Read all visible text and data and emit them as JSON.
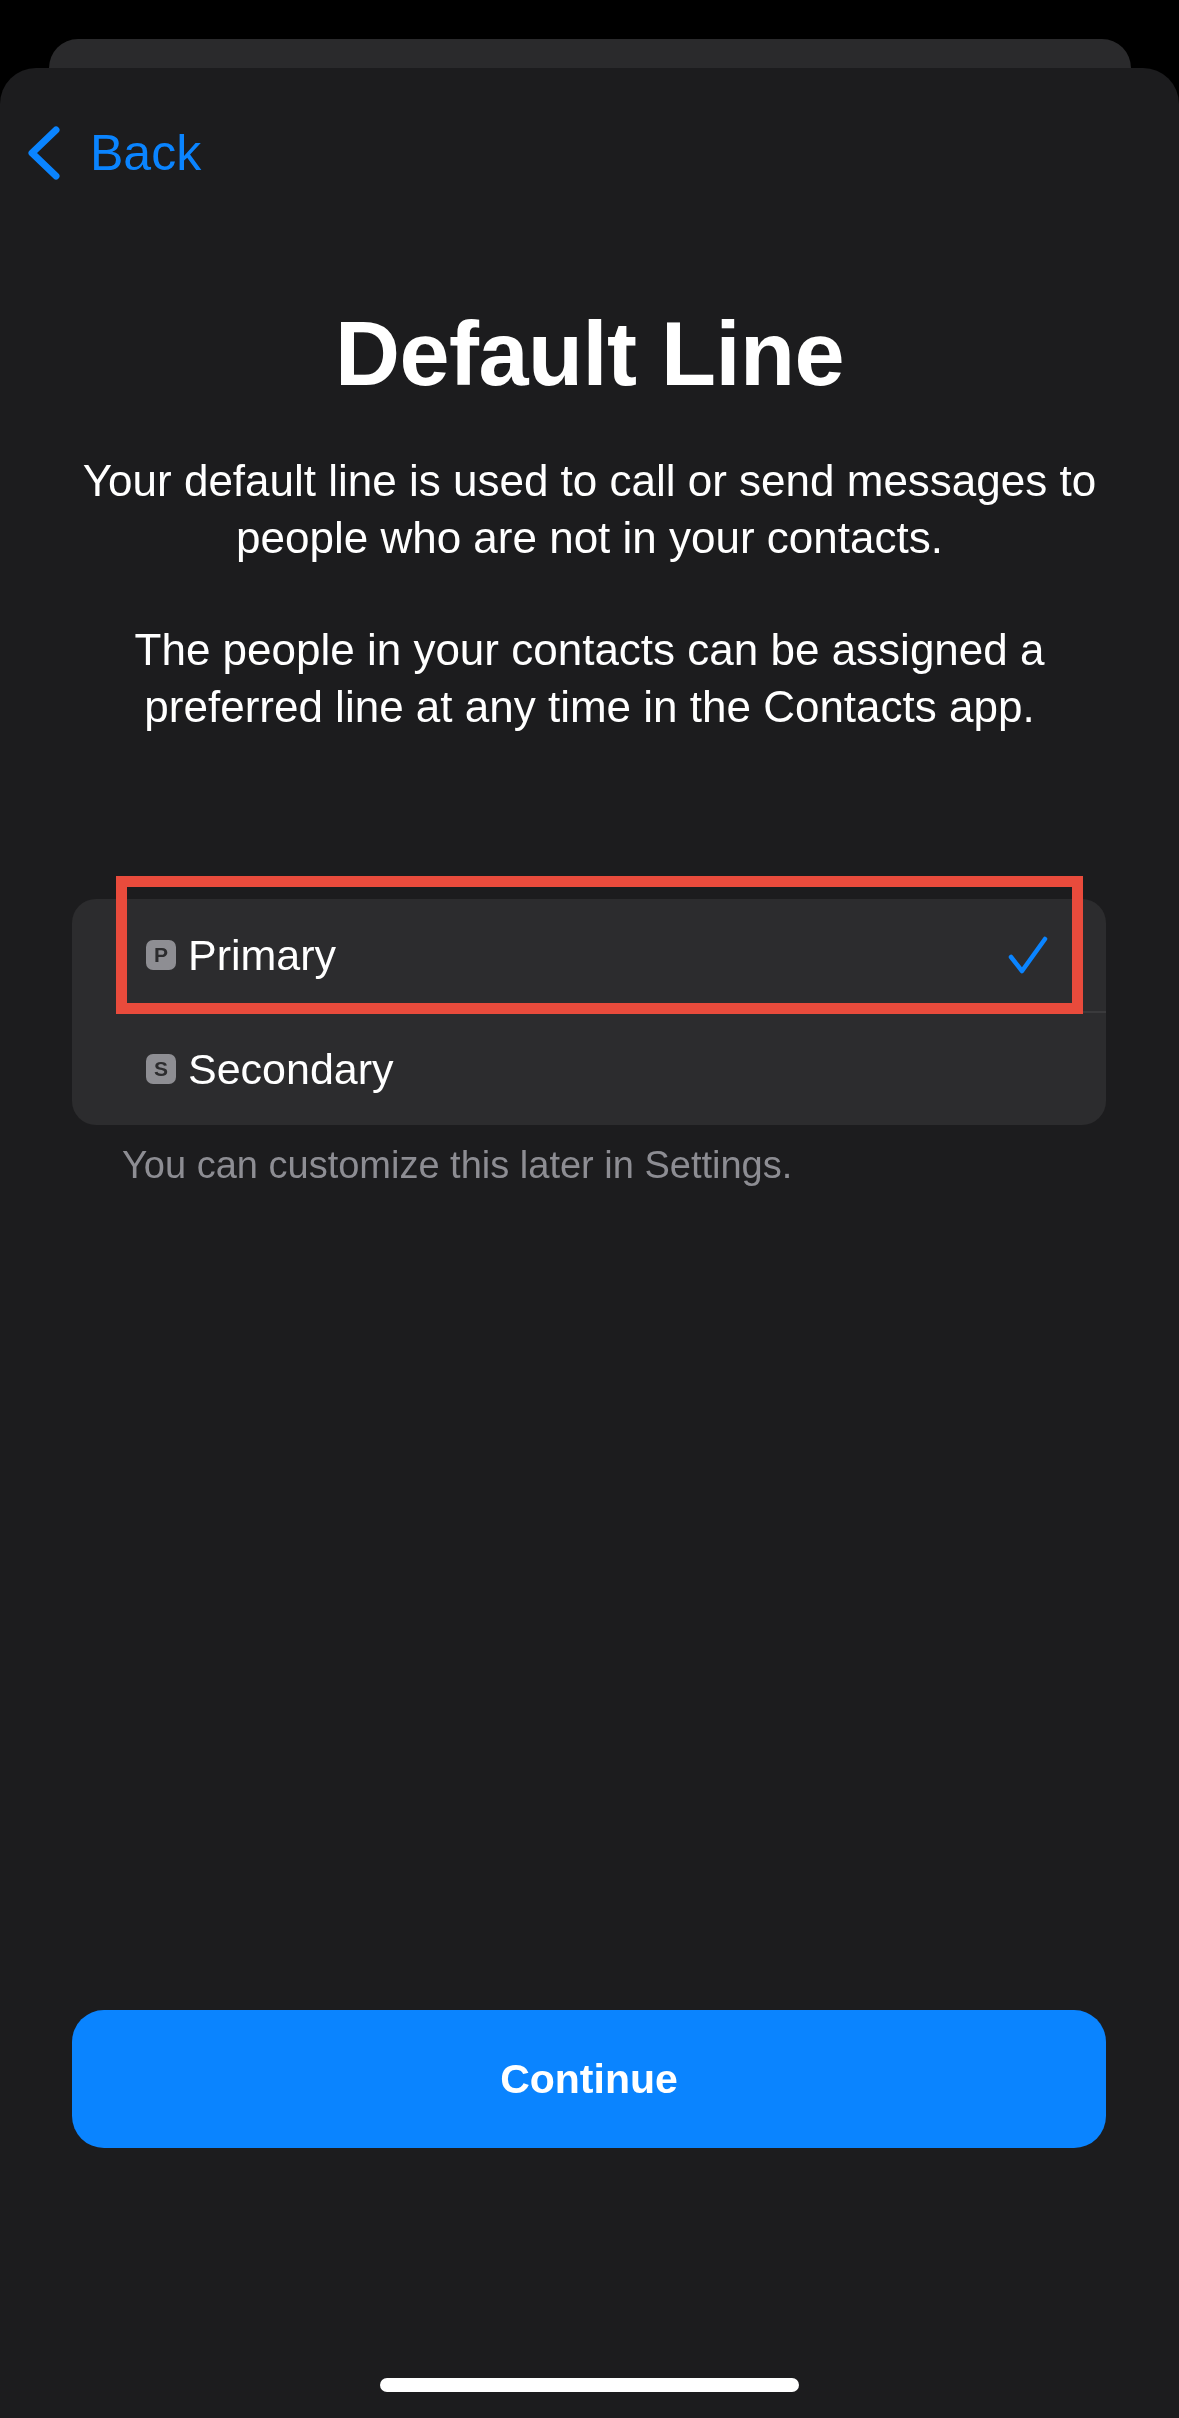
{
  "navigation": {
    "back_label": "Back"
  },
  "title": "Default Line",
  "paragraphs": [
    "Your default line is used to call or send messages to people who are not in your contacts.",
    "The people in your contacts can be assigned a preferred line at any time in the Contacts app."
  ],
  "lines": [
    {
      "badge": "P",
      "label": "Primary",
      "selected": true,
      "highlighted": true
    },
    {
      "badge": "S",
      "label": "Secondary",
      "selected": false,
      "highlighted": false
    }
  ],
  "footnote": "You can customize this later in Settings.",
  "primary_button": {
    "label": "Continue"
  }
}
